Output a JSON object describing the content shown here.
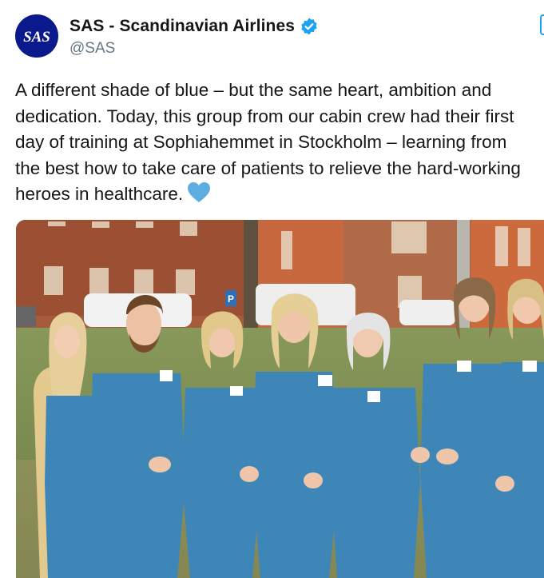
{
  "account": {
    "display_name": "SAS - Scandinavian Airlines",
    "handle": "@SAS",
    "logo_text": "SAS",
    "verified": true,
    "avatar_color": "#0a1a8c",
    "verified_color": "#1da1f2"
  },
  "tweet": {
    "lines": [
      "A different shade of blue – but the same heart, ambition and",
      "dedication. Today, this group from our cabin crew had their first",
      "day of training at Sophiahemmet in Stockholm – learning from",
      "the best how to take care of patients to relieve the hard-working",
      "heroes in healthcare."
    ],
    "emoji": "blue-heart-icon"
  },
  "photo": {
    "parking_sign": "P",
    "people": [
      {
        "role": "cabin-crew-member",
        "scrubs_color": "#3f86b8"
      },
      {
        "role": "cabin-crew-member",
        "scrubs_color": "#3f86b8"
      },
      {
        "role": "cabin-crew-member",
        "scrubs_color": "#3f86b8"
      },
      {
        "role": "cabin-crew-member",
        "scrubs_color": "#3f86b8"
      },
      {
        "role": "cabin-crew-member",
        "scrubs_color": "#3f86b8"
      },
      {
        "role": "cabin-crew-member",
        "scrubs_color": "#3f86b8"
      },
      {
        "role": "cabin-crew-member",
        "scrubs_color": "#3f86b8"
      }
    ]
  }
}
